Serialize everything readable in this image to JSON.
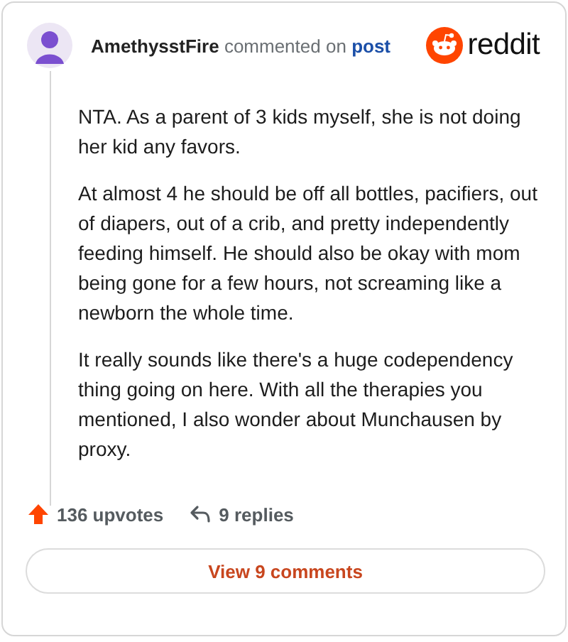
{
  "comment": {
    "author": "AmethysstFire",
    "action": "commented on",
    "target": "post"
  },
  "brand": {
    "name": "reddit"
  },
  "paragraphs": [
    "NTA. As a parent of 3 kids myself, she is not doing her kid any favors.",
    "At almost 4 he should be off all bottles, pacifiers, out of diapers, out of a crib, and pretty independently feeding himself. He should also be okay with mom being gone for a few hours, not screaming like a newborn the whole time.",
    "It really sounds like there's a huge codependency thing going on here. With all the therapies you mentioned, I also wonder about Munchausen by proxy."
  ],
  "stats": {
    "upvotes": "136 upvotes",
    "replies": "9 replies"
  },
  "button": "View 9 comments"
}
